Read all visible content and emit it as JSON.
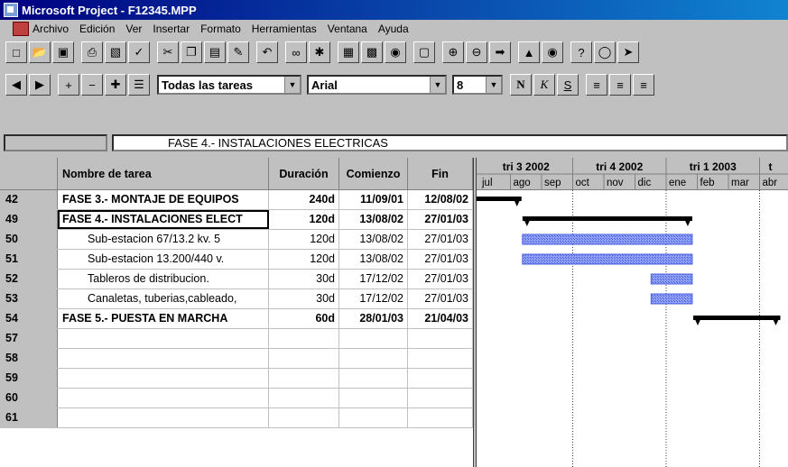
{
  "window": {
    "title": "Microsoft Project - F12345.MPP"
  },
  "menu": [
    "Archivo",
    "Edición",
    "Ver",
    "Insertar",
    "Formato",
    "Herramientas",
    "Ventana",
    "Ayuda"
  ],
  "toolbar2": {
    "filter_value": "Todas las tareas",
    "font_value": "Arial",
    "size_value": "8",
    "bold_label": "N",
    "italic_label": "K",
    "underline_label": "S"
  },
  "entry_bar": {
    "text": "FASE 4.- INSTALACIONES ELECTRICAS"
  },
  "table": {
    "headers": {
      "name": "Nombre de tarea",
      "duration": "Duración",
      "start": "Comienzo",
      "end": "Fin"
    },
    "rows": [
      {
        "id": "42",
        "name": "FASE 3.- MONTAJE DE EQUIPOS",
        "duration": "240d",
        "start": "11/09/01",
        "end": "12/08/02",
        "bold": true
      },
      {
        "id": "49",
        "name": "FASE 4.- INSTALACIONES ELECT",
        "duration": "120d",
        "start": "13/08/02",
        "end": "27/01/03",
        "bold": true
      },
      {
        "id": "50",
        "name": "Sub-estacion 67/13.2 kv.   5",
        "duration": "120d",
        "start": "13/08/02",
        "end": "27/01/03",
        "bold": false
      },
      {
        "id": "51",
        "name": "Sub-estacion 13.200/440 v.",
        "duration": "120d",
        "start": "13/08/02",
        "end": "27/01/03",
        "bold": false
      },
      {
        "id": "52",
        "name": "Tableros de distribucion.",
        "duration": "30d",
        "start": "17/12/02",
        "end": "27/01/03",
        "bold": false
      },
      {
        "id": "53",
        "name": "Canaletas, tuberias,cableado,",
        "duration": "30d",
        "start": "17/12/02",
        "end": "27/01/03",
        "bold": false
      },
      {
        "id": "54",
        "name": "FASE 5.- PUESTA EN MARCHA",
        "duration": "60d",
        "start": "28/01/03",
        "end": "21/04/03",
        "bold": true
      },
      {
        "id": "57",
        "name": "",
        "duration": "",
        "start": "",
        "end": "",
        "bold": false
      },
      {
        "id": "58",
        "name": "",
        "duration": "",
        "start": "",
        "end": "",
        "bold": false
      },
      {
        "id": "59",
        "name": "",
        "duration": "",
        "start": "",
        "end": "",
        "bold": false
      },
      {
        "id": "60",
        "name": "",
        "duration": "",
        "start": "",
        "end": "",
        "bold": false
      },
      {
        "id": "61",
        "name": "",
        "duration": "",
        "start": "",
        "end": "",
        "bold": false
      }
    ]
  },
  "gantt": {
    "quarters": [
      "tri 3 2002",
      "tri 4 2002",
      "tri 1 2003",
      "t"
    ],
    "months": [
      "jul",
      "ago",
      "sep",
      "oct",
      "nov",
      "dic",
      "ene",
      "feb",
      "mar",
      "abr"
    ],
    "bars": [
      {
        "row": "42",
        "type": "summary",
        "start": "11/09/01",
        "end": "12/08/02"
      },
      {
        "row": "49",
        "type": "summary",
        "start": "13/08/02",
        "end": "27/01/03"
      },
      {
        "row": "50",
        "type": "task",
        "start": "13/08/02",
        "end": "27/01/03"
      },
      {
        "row": "51",
        "type": "task",
        "start": "13/08/02",
        "end": "27/01/03"
      },
      {
        "row": "52",
        "type": "task",
        "start": "17/12/02",
        "end": "27/01/03"
      },
      {
        "row": "53",
        "type": "task",
        "start": "17/12/02",
        "end": "27/01/03"
      },
      {
        "row": "54",
        "type": "summary",
        "start": "28/01/03",
        "end": "21/04/03"
      }
    ],
    "colors": {
      "summary": "#000000",
      "task": "#4a5ee0",
      "task_pattern": "#8fa0f4"
    }
  }
}
